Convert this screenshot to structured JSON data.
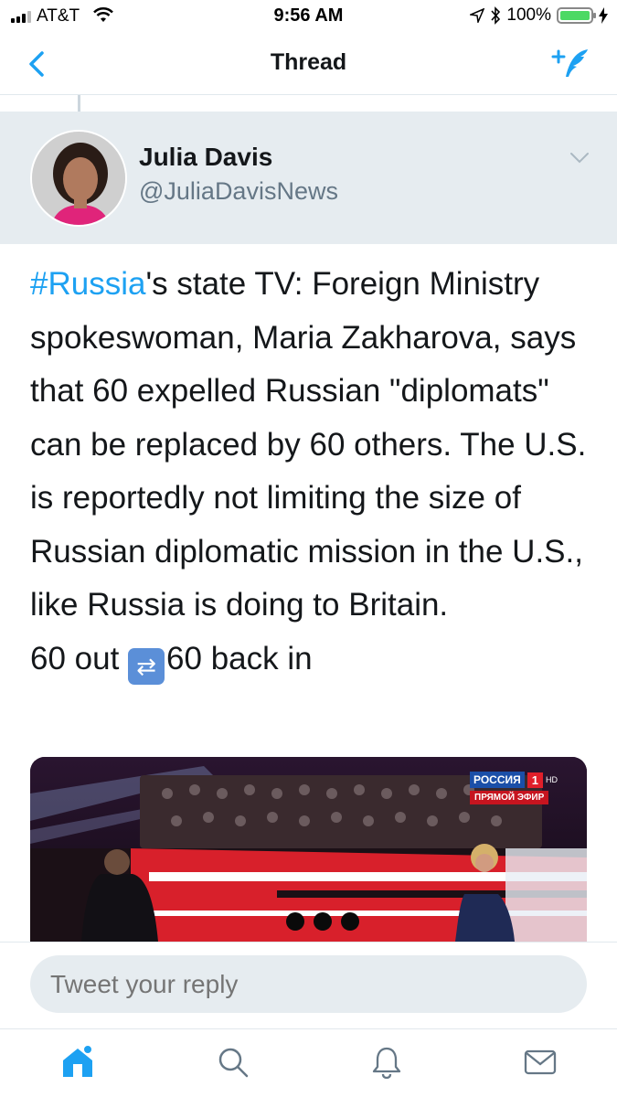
{
  "status_bar": {
    "carrier": "AT&T",
    "time": "9:56 AM",
    "battery_percent": "100%",
    "battery_level": 1.0
  },
  "nav": {
    "title": "Thread",
    "back_icon": "chevron-left-icon",
    "compose_icon": "compose-tweet-icon"
  },
  "tweet": {
    "author_name": "Julia Davis",
    "author_handle": "@JuliaDavisNews",
    "hashtag": "#Russia",
    "text_after_hashtag": "'s state TV: Foreign Ministry spokeswoman, Maria Zakharova, says that 60 expelled Russian \"diplomats\" can be replaced by 60 others. The U.S. is reportedly not limiting the size of Russian diplomatic mission in the U.S., like Russia is doing to Britain.",
    "text_line_end_1": "60 out ",
    "text_line_end_2": "60 back in",
    "media": {
      "channel_name": "РОССИЯ",
      "channel_number": "1",
      "channel_hd": "HD",
      "live_label": "ПРЯМОЙ ЭФИР"
    }
  },
  "reply": {
    "placeholder": "Tweet your reply"
  },
  "tabs": [
    {
      "icon": "home-icon",
      "active": true
    },
    {
      "icon": "search-icon",
      "active": false
    },
    {
      "icon": "notifications-icon",
      "active": false
    },
    {
      "icon": "messages-icon",
      "active": false
    }
  ],
  "colors": {
    "accent": "#1da1f2",
    "header_bg": "#e6ecf0",
    "muted_text": "#657786"
  }
}
